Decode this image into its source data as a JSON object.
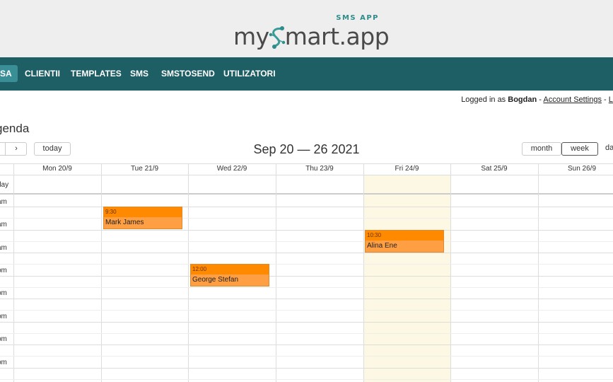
{
  "brand": {
    "logo_text": "mySmart.app",
    "logo_my": "my",
    "logo_rest": "mart.app",
    "sub": "SMS APP",
    "accent": "#2e8c8a"
  },
  "nav": {
    "items": [
      {
        "label": "SA",
        "active": true
      },
      {
        "label": "CLIENTII"
      },
      {
        "label": "TEMPLATES"
      },
      {
        "label": "SMS"
      },
      {
        "label": "SMSTOSEND"
      },
      {
        "label": "UTILIZATORI"
      }
    ],
    "bg_color": "#1e5f65"
  },
  "login": {
    "prefix": "Logged in as",
    "user": "Bogdan",
    "sep1": "-",
    "account_settings": "Account Settings",
    "sep2": "-",
    "logout": "Lo"
  },
  "page_title": "genda",
  "toolbar": {
    "next_label": "›",
    "today_label": "today",
    "title": "Sep 20 — 26 2021",
    "month_label": "month",
    "week_label": "week",
    "day_label": "da"
  },
  "calendar": {
    "days": [
      "Mon 20/9",
      "Tue 21/9",
      "Wed 22/9",
      "Thu 23/9",
      "Fri 24/9",
      "Sat 25/9",
      "Sun 26/9"
    ],
    "allday_label": "day",
    "time_labels": [
      "am",
      "am",
      "am",
      "pm",
      "pm",
      "pm",
      "pm",
      "pm"
    ],
    "today_highlight": "#fcf8e3",
    "events": [
      {
        "time": "9:30",
        "title": "Mark James",
        "day": "Tue 21/9"
      },
      {
        "time": "12:00",
        "title": "George Stefan",
        "day": "Wed 22/9"
      },
      {
        "time": "10:30",
        "title": "Alina Ene",
        "day": "Fri 24/9"
      }
    ],
    "event_color": "#ff9f43"
  }
}
